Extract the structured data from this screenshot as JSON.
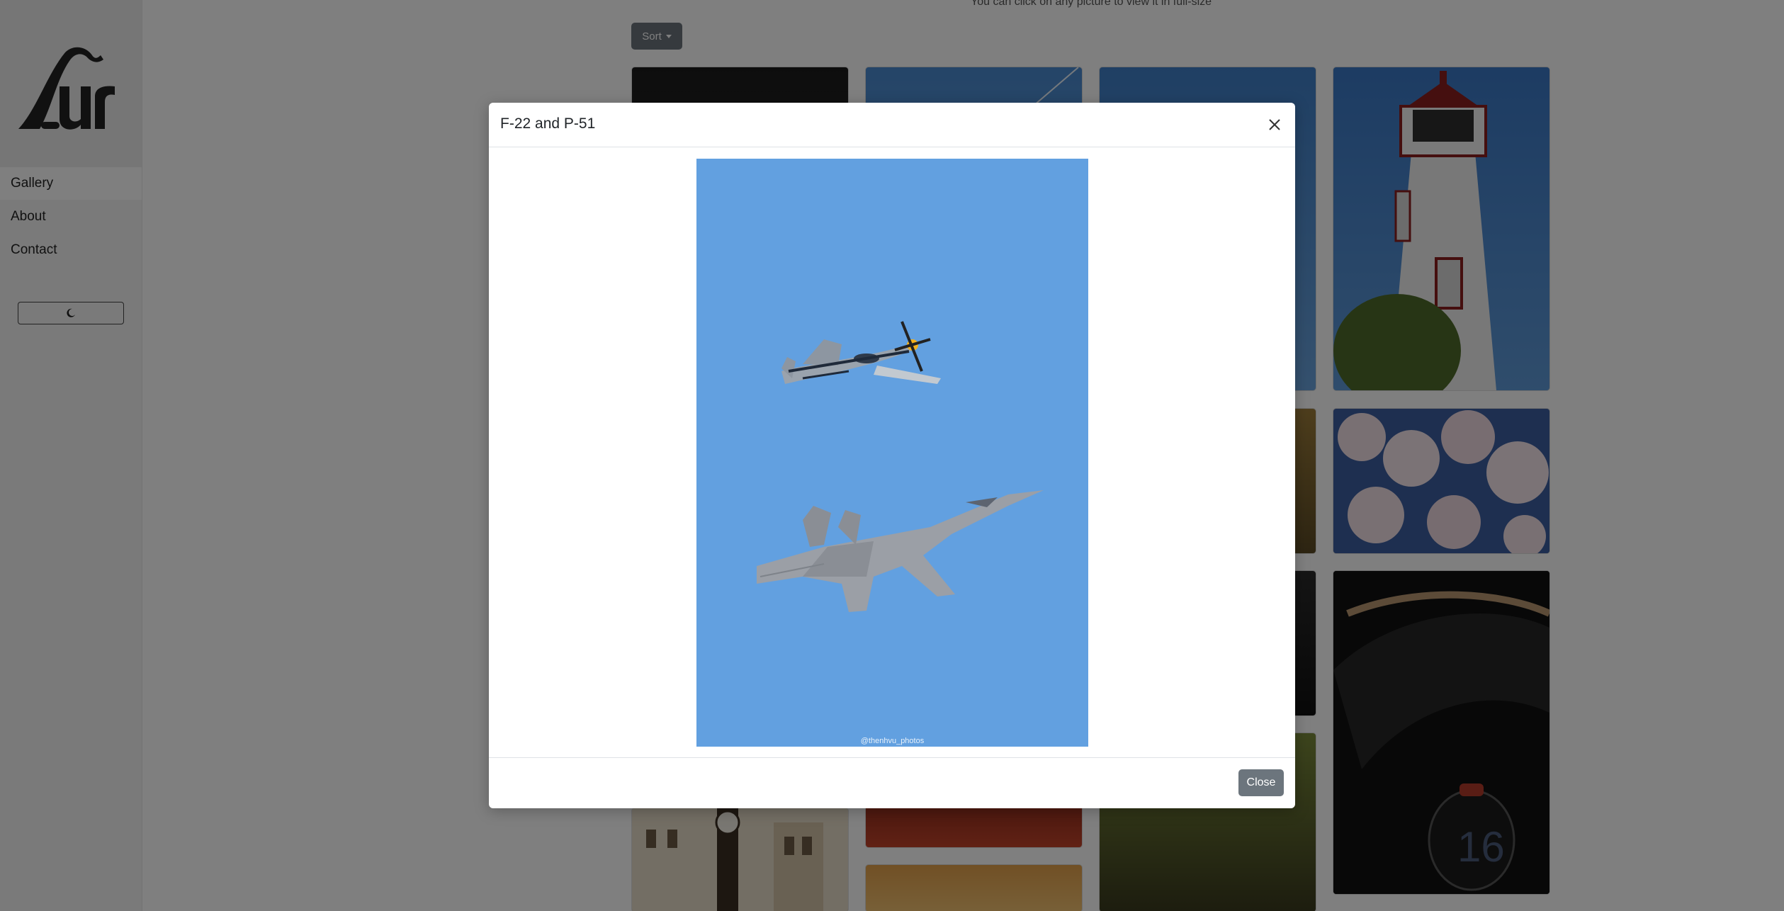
{
  "nav": {
    "items": [
      {
        "label": "Gallery",
        "active": true
      },
      {
        "label": "About",
        "active": false
      },
      {
        "label": "Contact",
        "active": false
      }
    ],
    "theme_toggle_icon": "moon-icon"
  },
  "main": {
    "hint": "You can click on any picture to view it in full-size",
    "sort_label": "Sort"
  },
  "modal": {
    "title": "F-22 and P-51",
    "watermark": "@thenhvu_photos",
    "close_label": "Close"
  },
  "colors": {
    "secondary_button": "#6c757d",
    "sky": "#62a0e0"
  }
}
